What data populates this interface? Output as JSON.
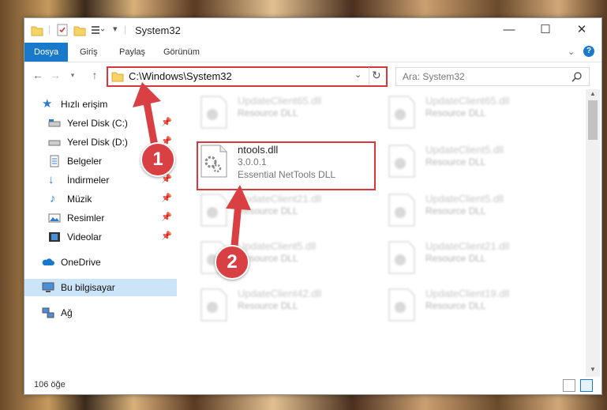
{
  "window": {
    "title": "System32",
    "minimize": "—",
    "maximize": "☐",
    "close": "✕"
  },
  "ribbon": {
    "tabs": [
      "Dosya",
      "Giriş",
      "Paylaş",
      "Görünüm"
    ],
    "help": "?"
  },
  "address": {
    "path": "C:\\Windows\\System32",
    "search_placeholder": "Ara: System32"
  },
  "sidebar": {
    "items": [
      {
        "label": "Hızlı erişim",
        "icon": "star-icon"
      },
      {
        "label": "Yerel Disk (C:)",
        "icon": "drive-icon",
        "pinned": true
      },
      {
        "label": "Yerel Disk (D:)",
        "icon": "drive-icon",
        "pinned": true
      },
      {
        "label": "Belgeler",
        "icon": "document-icon",
        "pinned": true
      },
      {
        "label": "İndirmeler",
        "icon": "download-icon",
        "pinned": true
      },
      {
        "label": "Müzik",
        "icon": "music-icon",
        "pinned": true
      },
      {
        "label": "Resimler",
        "icon": "pictures-icon",
        "pinned": true
      },
      {
        "label": "Videolar",
        "icon": "video-icon",
        "pinned": true
      },
      {
        "label": "OneDrive",
        "icon": "cloud-icon"
      },
      {
        "label": "Bu bilgisayar",
        "icon": "computer-icon",
        "selected": true
      },
      {
        "label": "Ağ",
        "icon": "network-icon"
      }
    ]
  },
  "files": {
    "left": [
      {
        "name": "UpdateClient65.dll",
        "line2": "Resource DLL",
        "line3": ""
      },
      {
        "name": "ntools.dll",
        "line2": "3.0.0.1",
        "line3": "Essential NetTools DLL"
      },
      {
        "name": "UpdateClient21.dll",
        "line2": "Resource DLL",
        "line3": ""
      },
      {
        "name": "UpdateClient5.dll",
        "line2": "Resource DLL",
        "line3": ""
      },
      {
        "name": "UpdateClient42.dll",
        "line2": "Resource DLL",
        "line3": ""
      }
    ],
    "right": [
      {
        "name": "UpdateClient65.dll",
        "line2": "Resource DLL"
      },
      {
        "name": "UpdateClient5.dll",
        "line2": "Resource DLL"
      },
      {
        "name": "UpdateClient5.dll",
        "line2": "Resource DLL"
      },
      {
        "name": "UpdateClient21.dll",
        "line2": "Resource DLL"
      },
      {
        "name": "UpdateClient19.dll",
        "line2": "Resource DLL"
      }
    ]
  },
  "status": {
    "count": "106 öğe"
  },
  "callouts": [
    "1",
    "2"
  ],
  "colors": {
    "accent": "#1979ca",
    "highlight": "#d9373c",
    "selected": "#cce4f7"
  }
}
